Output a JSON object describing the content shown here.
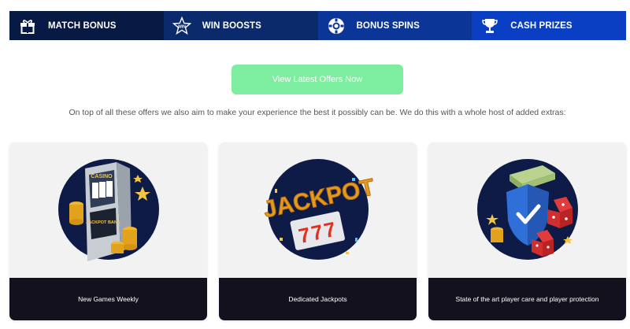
{
  "tabs": [
    {
      "label": "MATCH BONUS",
      "icon": "gift-icon"
    },
    {
      "label": "WIN BOOSTS",
      "icon": "star-badge-icon"
    },
    {
      "label": "BONUS SPINS",
      "icon": "roulette-chip-icon"
    },
    {
      "label": "CASH PRIZES",
      "icon": "trophy-icon"
    }
  ],
  "cta": {
    "label": "View Latest Offers Now"
  },
  "intro": "On top of all these offers we also aim to make your experience the best it possibly can be. We do this with a whole host of added extras:",
  "cards": [
    {
      "title": "New Games Weekly",
      "icon": "slot-machine-illustration",
      "slot_sign": "CASINO",
      "panel_text": "JACKPOT BANK"
    },
    {
      "title": "Dedicated Jackpots",
      "icon": "jackpot-777-illustration",
      "word": "JACKPOT",
      "reels": "777"
    },
    {
      "title": "State of the art player care and player protection",
      "icon": "shield-dice-illustration"
    }
  ],
  "colors": {
    "cta": "#7ded9f",
    "tab_1": "#071a43",
    "tab_4": "#0a3fc4",
    "card_footer": "#14111f",
    "illustration_bg": "#0f1b47"
  }
}
